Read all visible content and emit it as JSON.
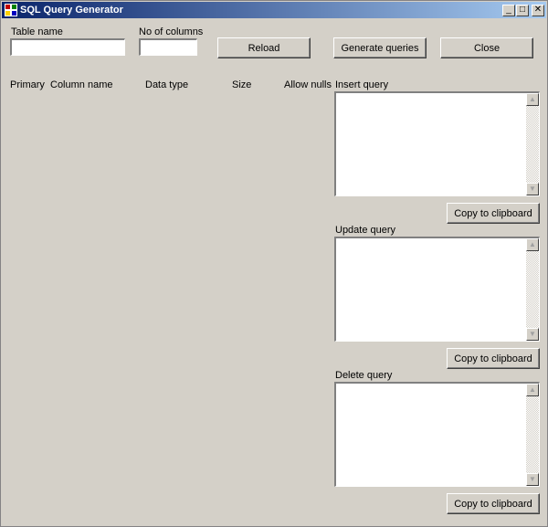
{
  "window": {
    "title": "SQL Query Generator",
    "controls": {
      "minimize": "_",
      "maximize": "□",
      "close": "✕"
    }
  },
  "form": {
    "table_name_label": "Table name",
    "table_name_value": "",
    "columns_label": "No of columns",
    "columns_value": "",
    "reload_label": "Reload",
    "generate_label": "Generate queries",
    "close_label": "Close"
  },
  "columns_header": {
    "primary": "Primary",
    "column_name": "Column name",
    "data_type": "Data type",
    "size": "Size",
    "allow_nulls": "Allow nulls"
  },
  "queries": {
    "insert": {
      "label": "Insert query",
      "value": "",
      "copy_label": "Copy to clipboard"
    },
    "update": {
      "label": "Update query",
      "value": "",
      "copy_label": "Copy to clipboard"
    },
    "delete": {
      "label": "Delete query",
      "value": "",
      "copy_label": "Copy to clipboard"
    }
  },
  "icons": {
    "app": "app-icon",
    "scroll_up": "▲",
    "scroll_down": "▼"
  }
}
